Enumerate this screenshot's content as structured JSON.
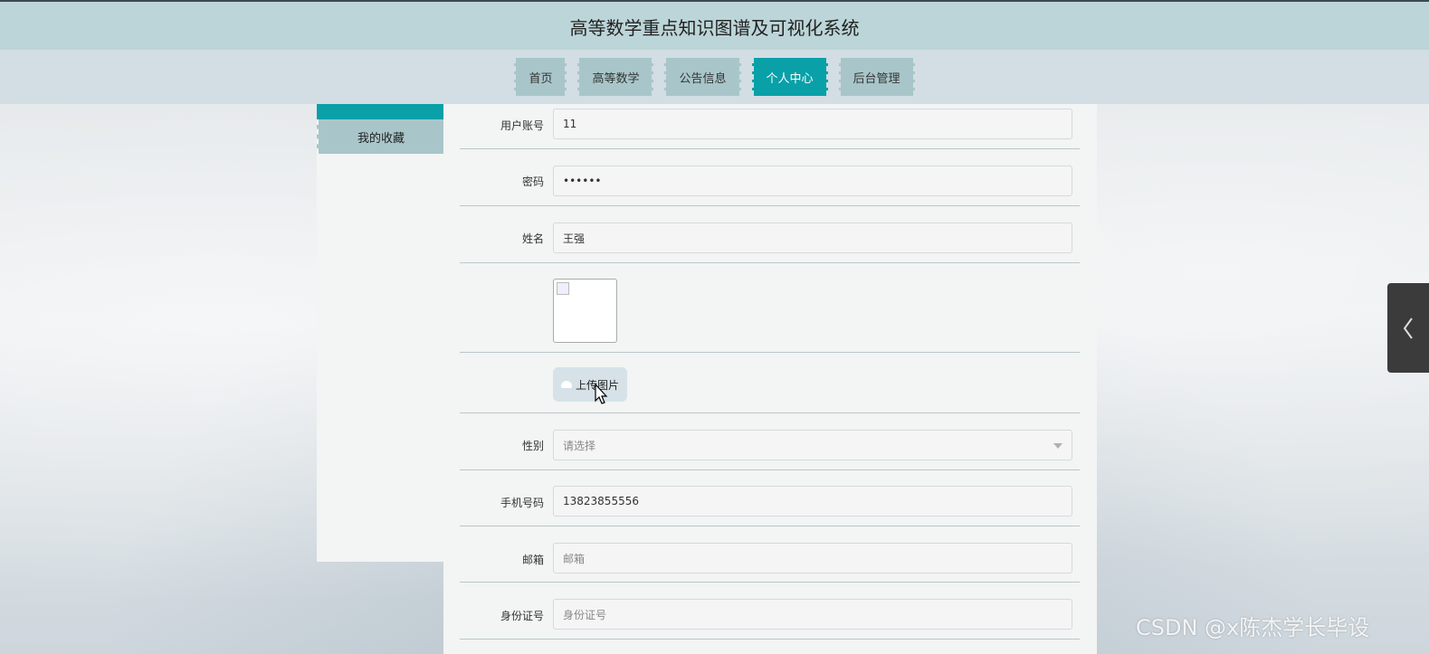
{
  "header": {
    "title": "高等数学重点知识图谱及可视化系统"
  },
  "nav": {
    "items": [
      {
        "label": "首页",
        "active": false
      },
      {
        "label": "高等数学",
        "active": false
      },
      {
        "label": "公告信息",
        "active": false
      },
      {
        "label": "个人中心",
        "active": true
      },
      {
        "label": "后台管理",
        "active": false
      }
    ]
  },
  "sidebar": {
    "items": [
      {
        "label": "我的收藏"
      }
    ]
  },
  "form": {
    "username": {
      "label": "用户账号",
      "value": "11"
    },
    "password": {
      "label": "密码",
      "value": "••••••"
    },
    "name": {
      "label": "姓名",
      "value": "王强"
    },
    "upload": {
      "label": "上传图片"
    },
    "gender": {
      "label": "性别",
      "placeholder": "请选择"
    },
    "phone": {
      "label": "手机号码",
      "value": "13823855556"
    },
    "email": {
      "label": "邮箱",
      "placeholder": "邮箱"
    },
    "idcard": {
      "label": "身份证号",
      "placeholder": "身份证号"
    }
  },
  "watermark": "CSDN @x陈杰学长毕设",
  "colors": {
    "accent": "#09a0a8",
    "nav_bg": "#a8c6c9",
    "title_bg": "#bcd5d8"
  }
}
